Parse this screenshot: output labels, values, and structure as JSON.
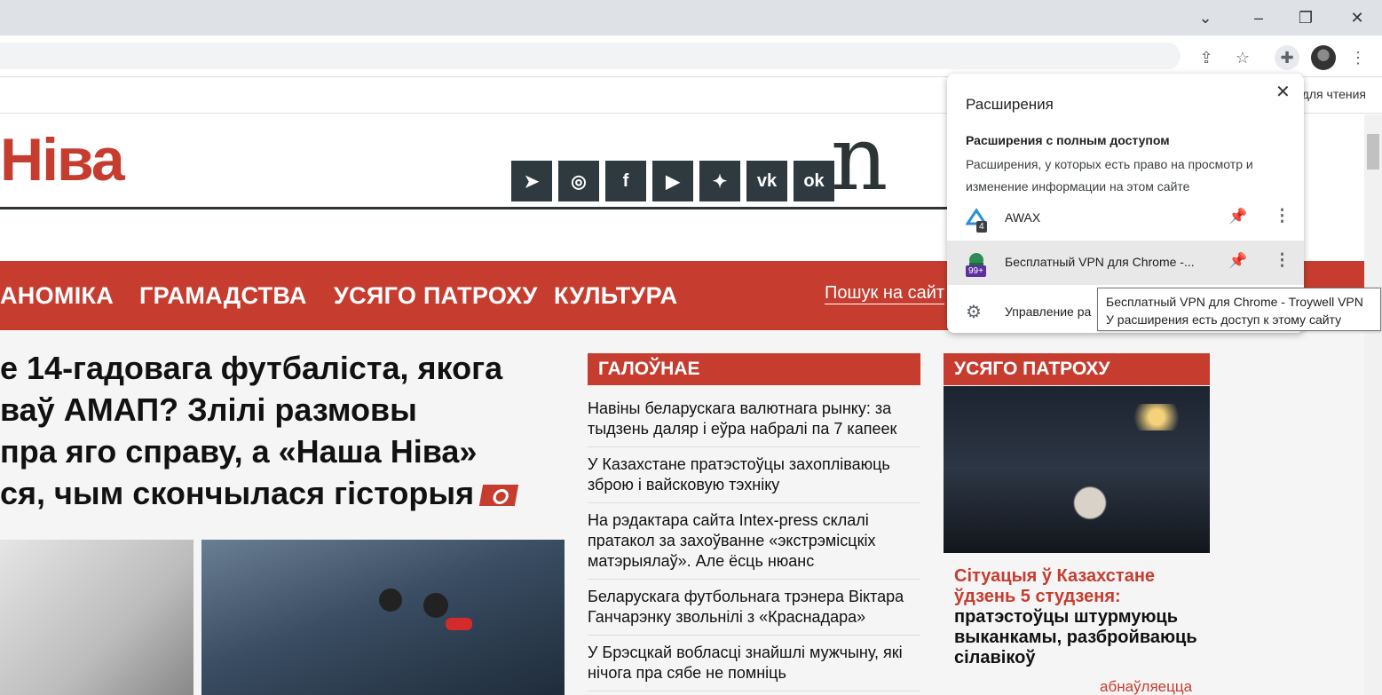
{
  "browser": {
    "reading_list_label": "для чтения",
    "window_controls": [
      "chevron-down-icon",
      "minimize-icon",
      "restore-icon",
      "close-icon"
    ],
    "toolbar_icons": [
      "share-icon",
      "star-icon",
      "puzzle-icon",
      "avatar",
      "more-vert-icon"
    ]
  },
  "site": {
    "logo": "Ніва",
    "big_letter": "n",
    "social": [
      "telegram-icon",
      "instagram-icon",
      "facebook-icon",
      "youtube-icon",
      "twitter-icon",
      "vk-icon",
      "odnoklassniki-icon"
    ],
    "nav": {
      "items": [
        "АНОМІКА",
        "ГРАМАДСТВА",
        "УСЯГО ПАТРОХУ",
        "КУЛЬТУРА"
      ],
      "search": "Пошук на сайт"
    },
    "headline": {
      "lines": [
        "е 14-гадовага футбаліста, якога",
        "ваў АМАП? Злілі размовы",
        "пра яго справу, а «Наша Ніва»",
        "ся, чым скончылася гісторыя"
      ]
    },
    "main_column": {
      "header": "ГАЛОЎНАЕ",
      "news": [
        "Навіны беларускага валютнага рынку: за тыдзень даляр і еўра набралі па 7 капеек",
        "У Казахстане пратэстоўцы захопліваюць зброю і вайсковую тэхніку",
        "На рэдактара сайта Intex-press склалі пратакол за захоўванне «экстрэмісцкіх матэрыялаў». Але ёсць нюанс",
        "Беларускага футбольнага трэнера Віктара Ганчарэнку звольнілі з «Краснадара»",
        "У Брэсцкай вобласці знайшлі мужчыну, які нічога пра сябе не помніць"
      ]
    },
    "side_column": {
      "header": "УСЯГО ПАТРОХУ",
      "feature_title_red": "Сітуацыя ў Казахстане ўдзень 5 студзеня:",
      "feature_title_black": "пратэстоўцы штурмуюць выканкамы, разбройваюць сілавікоў",
      "update": "абнаўляецца"
    }
  },
  "extensions_popup": {
    "title": "Расширения",
    "section_title": "Расширения с полным доступом",
    "section_desc": "Расширения, у которых есть право на просмотр и изменение информации на этом сайте",
    "items": [
      {
        "name": "AWAX",
        "badge": "4"
      },
      {
        "name": "Бесплатный VPN для Chrome -...",
        "badge": "99+"
      }
    ],
    "manage_label": "Управление ра"
  },
  "tooltip": {
    "line1": "Бесплатный VPN для Chrome - Troywell VPN",
    "line2": "У расширения есть доступ к этому сайту"
  },
  "colors": {
    "brand_red": "#c63d30",
    "dark": "#2f3a40"
  }
}
